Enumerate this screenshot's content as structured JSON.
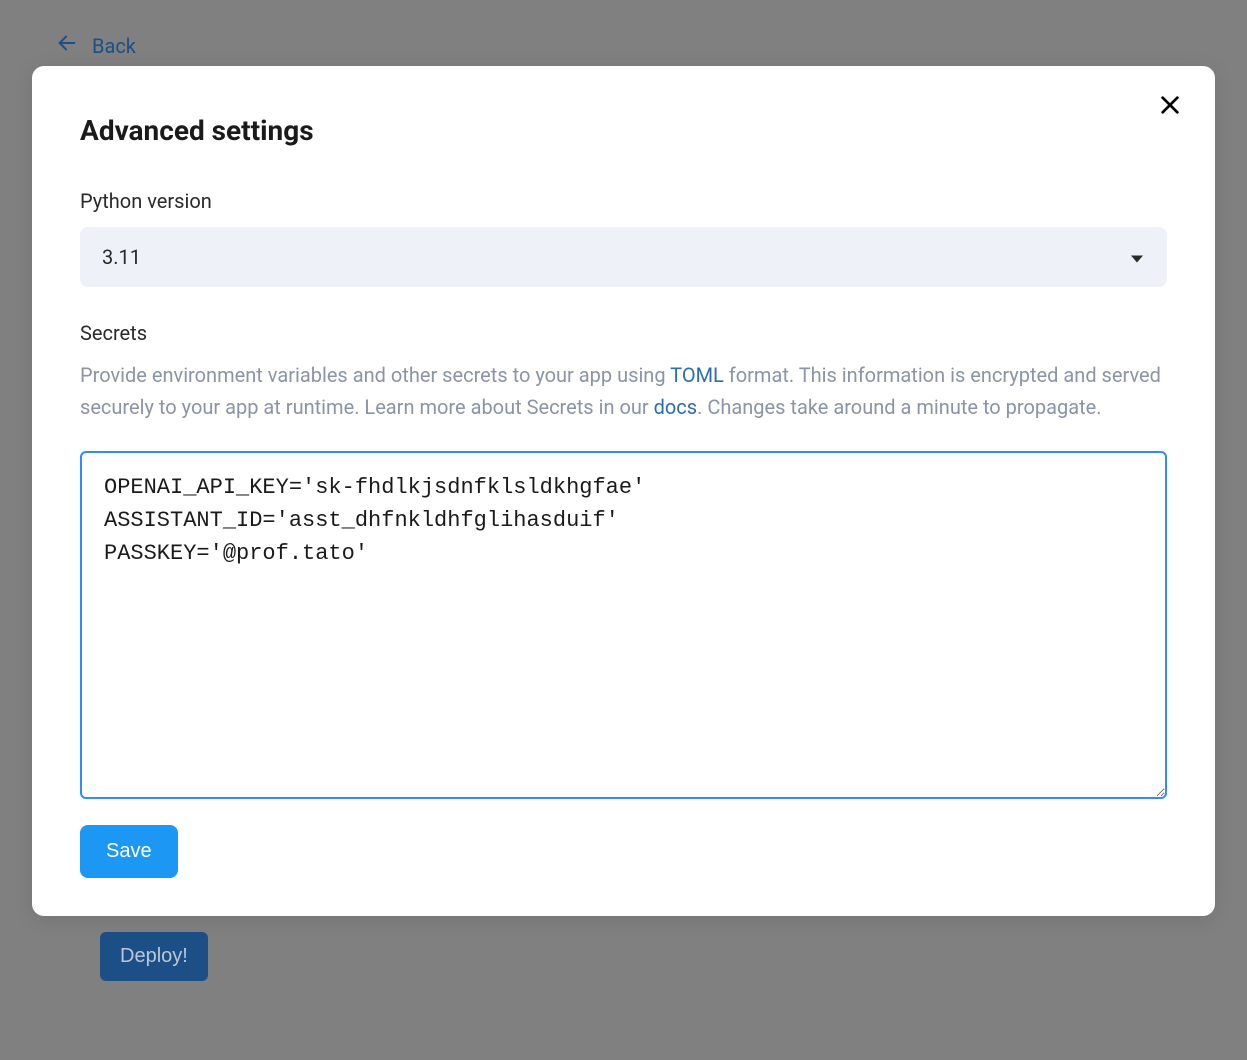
{
  "back": {
    "label": "Back"
  },
  "deploy": {
    "label": "Deploy!"
  },
  "modal": {
    "title": "Advanced settings",
    "python_version": {
      "label": "Python version",
      "value": "3.11"
    },
    "secrets": {
      "label": "Secrets",
      "desc_part1": "Provide environment variables and other secrets to your app using ",
      "desc_link1": "TOML",
      "desc_part2": " format. This information is encrypted and served securely to your app at runtime. Learn more about Secrets in our ",
      "desc_link2": "docs",
      "desc_part3": ". Changes take around a minute to propagate.",
      "value": "OPENAI_API_KEY='sk-fhdlkjsdnfklsldkhgfae'\nASSISTANT_ID='asst_dhfnkldhfglihasduif'\nPASSKEY='@prof.tato'"
    },
    "save_label": "Save"
  }
}
